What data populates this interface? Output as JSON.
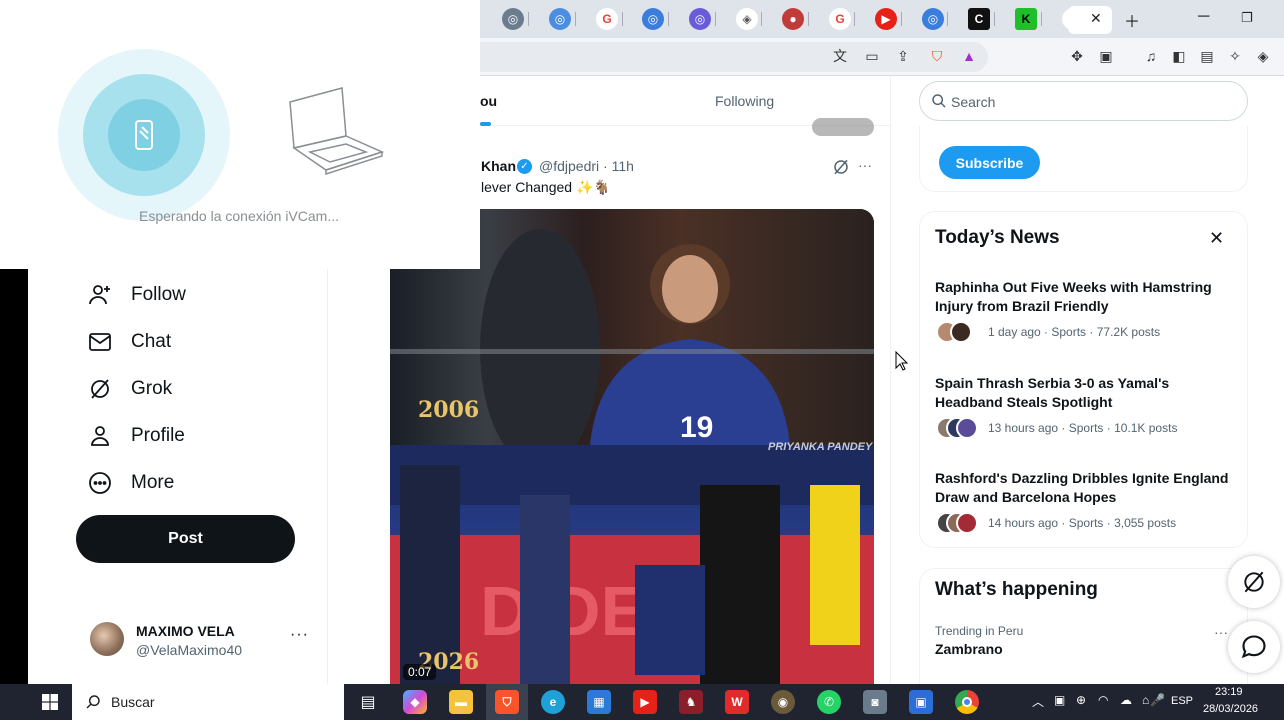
{
  "ivcam": {
    "status": "Esperando la conexión iVCam..."
  },
  "sidebar": {
    "items": [
      {
        "label": "Follow",
        "icon": "follow-icon"
      },
      {
        "label": "Chat",
        "icon": "chat-icon"
      },
      {
        "label": "Grok",
        "icon": "grok-icon"
      },
      {
        "label": "Profile",
        "icon": "profile-icon"
      },
      {
        "label": "More",
        "icon": "more-icon"
      }
    ],
    "post_label": "Post",
    "user": {
      "name": "MAXIMO VELA",
      "handle": "@VelaMaximo40",
      "more": "···"
    }
  },
  "timeline": {
    "tabs": [
      {
        "label": "ou"
      },
      {
        "label": "Following"
      }
    ],
    "tweet": {
      "name": "Khan",
      "handle": "@fdjpedri · 11h",
      "text": "lever Changed ✨🐐",
      "more": "···",
      "video": {
        "year_top": "2006",
        "year_bottom": "2026",
        "watermark": "PRIYANKA PANDEY",
        "time": "0:07"
      }
    }
  },
  "right": {
    "search_placeholder": "Search",
    "subscribe_label": "Subscribe",
    "news": {
      "title": "Today’s News",
      "close": "✕",
      "items": [
        {
          "headline": "Raphinha Out Five Weeks with Hamstring Injury from Brazil Friendly",
          "meta": "1 day ago · Sports · 77.2K posts"
        },
        {
          "headline": "Spain Thrash Serbia 3-0 as Yamal's Headband Steals Spotlight",
          "meta": "13 hours ago · Sports · 10.1K posts"
        },
        {
          "headline": "Rashford's Dazzling Dribbles Ignite England Draw and Barcelona Hopes",
          "meta": "14 hours ago · Sports · 3,055 posts"
        }
      ]
    },
    "happening": {
      "title": "What’s happening",
      "context": "Trending in Peru",
      "name": "Zambrano",
      "more": "···"
    }
  },
  "taskbar": {
    "search_placeholder": "Buscar",
    "lang": "ESP",
    "time": "23:19",
    "date": "28/03/2026"
  },
  "colors": {
    "accent": "#1d9bf0",
    "post_button": "#0f1419",
    "taskbar": "#1f2430",
    "ivcam_ring": "#7fd0e2"
  }
}
